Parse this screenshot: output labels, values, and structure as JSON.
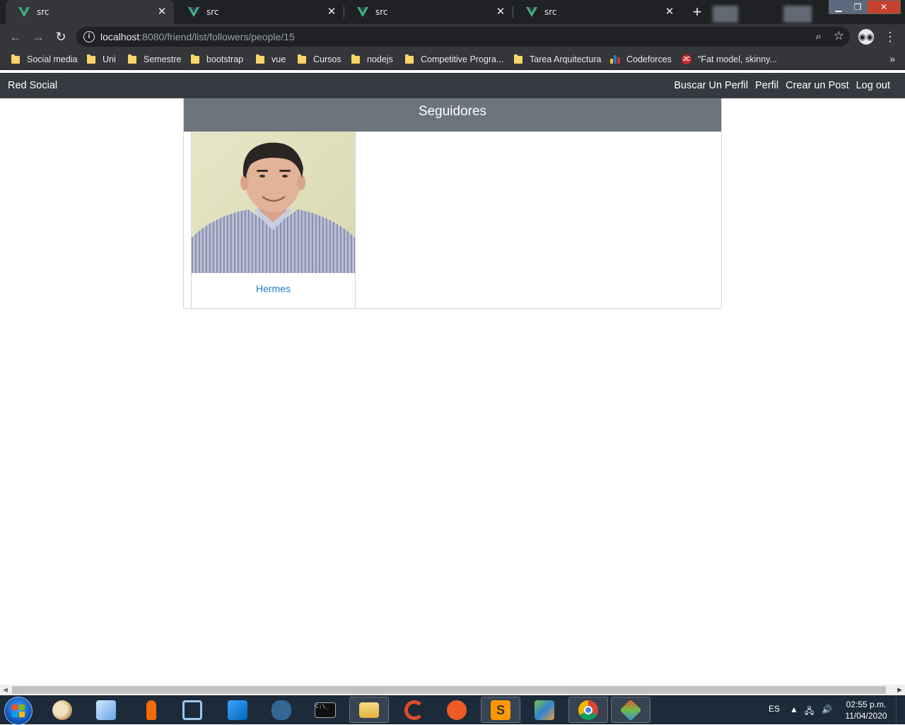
{
  "browser": {
    "tabs": [
      {
        "title": "src",
        "active": true
      },
      {
        "title": "src",
        "active": false
      },
      {
        "title": "src",
        "active": false
      },
      {
        "title": "src",
        "active": false
      }
    ],
    "url_host": "localhost",
    "url_path": ":8080/friend/list/followers/people/15",
    "bookmarks": [
      {
        "label": "Social media",
        "icon": "folder-icon"
      },
      {
        "label": "Uni",
        "icon": "folder-icon"
      },
      {
        "label": "Semestre",
        "icon": "folder-icon"
      },
      {
        "label": "bootstrap",
        "icon": "folder-icon"
      },
      {
        "label": "vue",
        "icon": "folder-icon"
      },
      {
        "label": "Cursos",
        "icon": "folder-icon"
      },
      {
        "label": "nodejs",
        "icon": "folder-icon"
      },
      {
        "label": "Competitive Progra...",
        "icon": "folder-icon"
      },
      {
        "label": "Tarea Arquitectura",
        "icon": "folder-icon"
      },
      {
        "label": "Codeforces",
        "icon": "codeforces-icon"
      },
      {
        "label": "\"Fat model, skinny...",
        "icon": "jc-icon"
      }
    ],
    "more_bookmarks": "»"
  },
  "app": {
    "brand": "Red Social",
    "nav": {
      "search_profile": "Buscar Un Perfil",
      "profile": "Perfil",
      "create_post": "Crear un Post",
      "logout": "Log out"
    },
    "card_title": "Seguidores",
    "followers": [
      {
        "name": "Hermes"
      }
    ]
  },
  "taskbar": {
    "language": "ES",
    "time": "02:55 p.m.",
    "date": "11/04/2020"
  },
  "colors": {
    "navbar": "#343a40",
    "card_header": "#6c757d",
    "link": "#1f7acc",
    "vue_green": "#41b883"
  }
}
